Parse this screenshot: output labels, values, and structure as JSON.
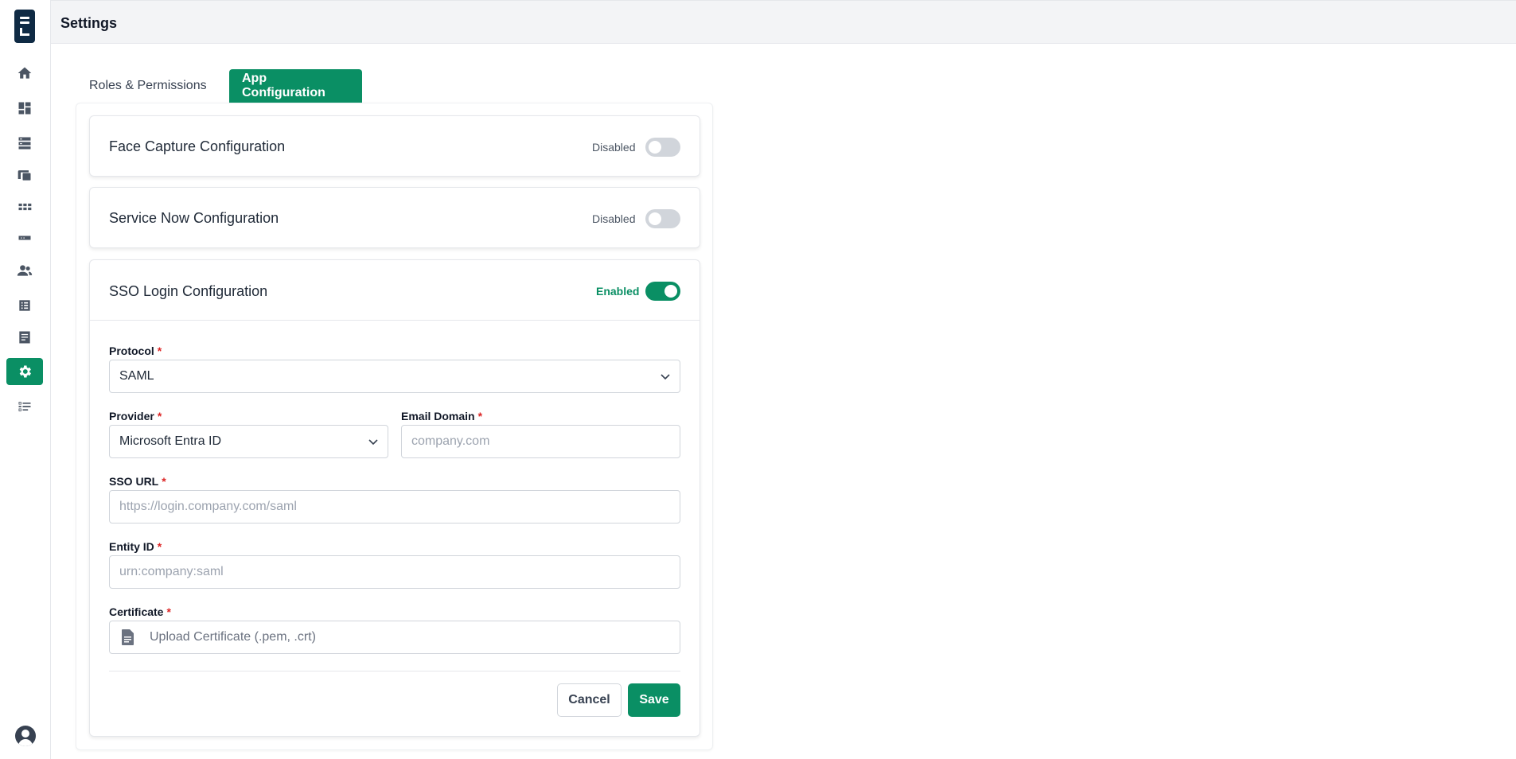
{
  "header": {
    "title": "Settings"
  },
  "sidebar": {
    "items": [
      {
        "icon": "home-icon",
        "active": false
      },
      {
        "icon": "dashboard-icon",
        "active": false
      },
      {
        "icon": "storage-icon",
        "active": false
      },
      {
        "icon": "devices-icon",
        "active": false
      },
      {
        "icon": "apps-grid-icon",
        "active": false
      },
      {
        "icon": "card-icon",
        "active": false
      },
      {
        "icon": "users-icon",
        "active": false
      },
      {
        "icon": "list-icon",
        "active": false
      },
      {
        "icon": "document-icon",
        "active": false
      },
      {
        "icon": "gear-icon",
        "active": true
      },
      {
        "icon": "checklist-icon",
        "active": false
      }
    ],
    "accent_color": "#0a8f64"
  },
  "tabs": [
    {
      "label": "Roles & Permissions",
      "active": false
    },
    {
      "label": "App Configuration",
      "active": true
    }
  ],
  "cards": {
    "face_capture": {
      "title": "Face Capture Configuration",
      "status": "Disabled",
      "enabled": false
    },
    "service_now": {
      "title": "Service Now Configuration",
      "status": "Disabled",
      "enabled": false
    },
    "sso": {
      "title": "SSO Login Configuration",
      "status": "Enabled",
      "enabled": true
    }
  },
  "form": {
    "required_marker": "*",
    "protocol": {
      "label": "Protocol",
      "value": "SAML"
    },
    "provider": {
      "label": "Provider",
      "value": "Microsoft Entra ID"
    },
    "email_domain": {
      "label": "Email Domain",
      "placeholder": "company.com"
    },
    "sso_url": {
      "label": "SSO URL",
      "placeholder": "https://login.company.com/saml"
    },
    "entity_id": {
      "label": "Entity ID",
      "placeholder": "urn:company:saml"
    },
    "certificate": {
      "label": "Certificate",
      "upload_text": "Upload Certificate (.pem, .crt)"
    }
  },
  "actions": {
    "cancel_label": "Cancel",
    "save_label": "Save"
  },
  "colors": {
    "primary": "#0a8f64",
    "required": "#dc2626",
    "toggle_off": "#d1d5db"
  }
}
